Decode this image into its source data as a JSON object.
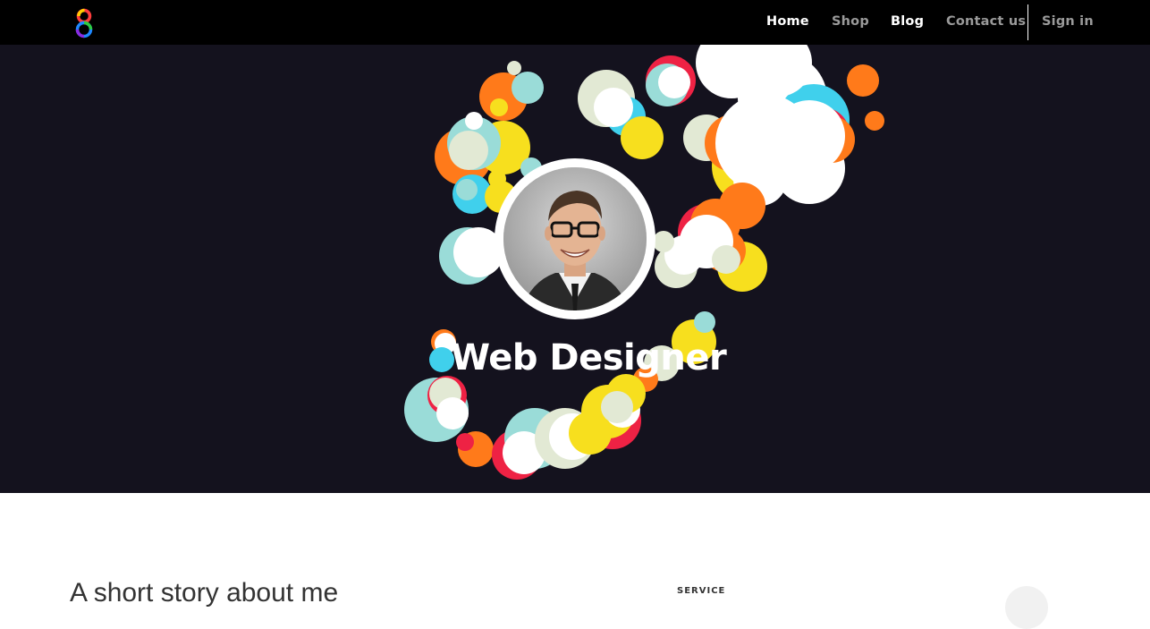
{
  "nav": {
    "items": [
      {
        "label": "Home",
        "state": "active"
      },
      {
        "label": "Shop",
        "state": "muted"
      },
      {
        "label": "Blog",
        "state": "active"
      },
      {
        "label": "Contact us",
        "state": "muted"
      },
      {
        "label": "Sign in",
        "state": "muted"
      }
    ]
  },
  "hero": {
    "title": "Web Designer",
    "bubble_colors": [
      "#ff7a1a",
      "#ee2244",
      "#f7df1e",
      "#40d0ec",
      "#9adcd8",
      "#e2e9d4",
      "#ffffff"
    ]
  },
  "section": {
    "heading": "A short story about me",
    "tag": "SERVICE"
  },
  "colors": {
    "navbar_bg": "#000000",
    "hero_bg": "#14121e",
    "nav_active": "#ffffff",
    "nav_muted": "#9a9a9a"
  }
}
